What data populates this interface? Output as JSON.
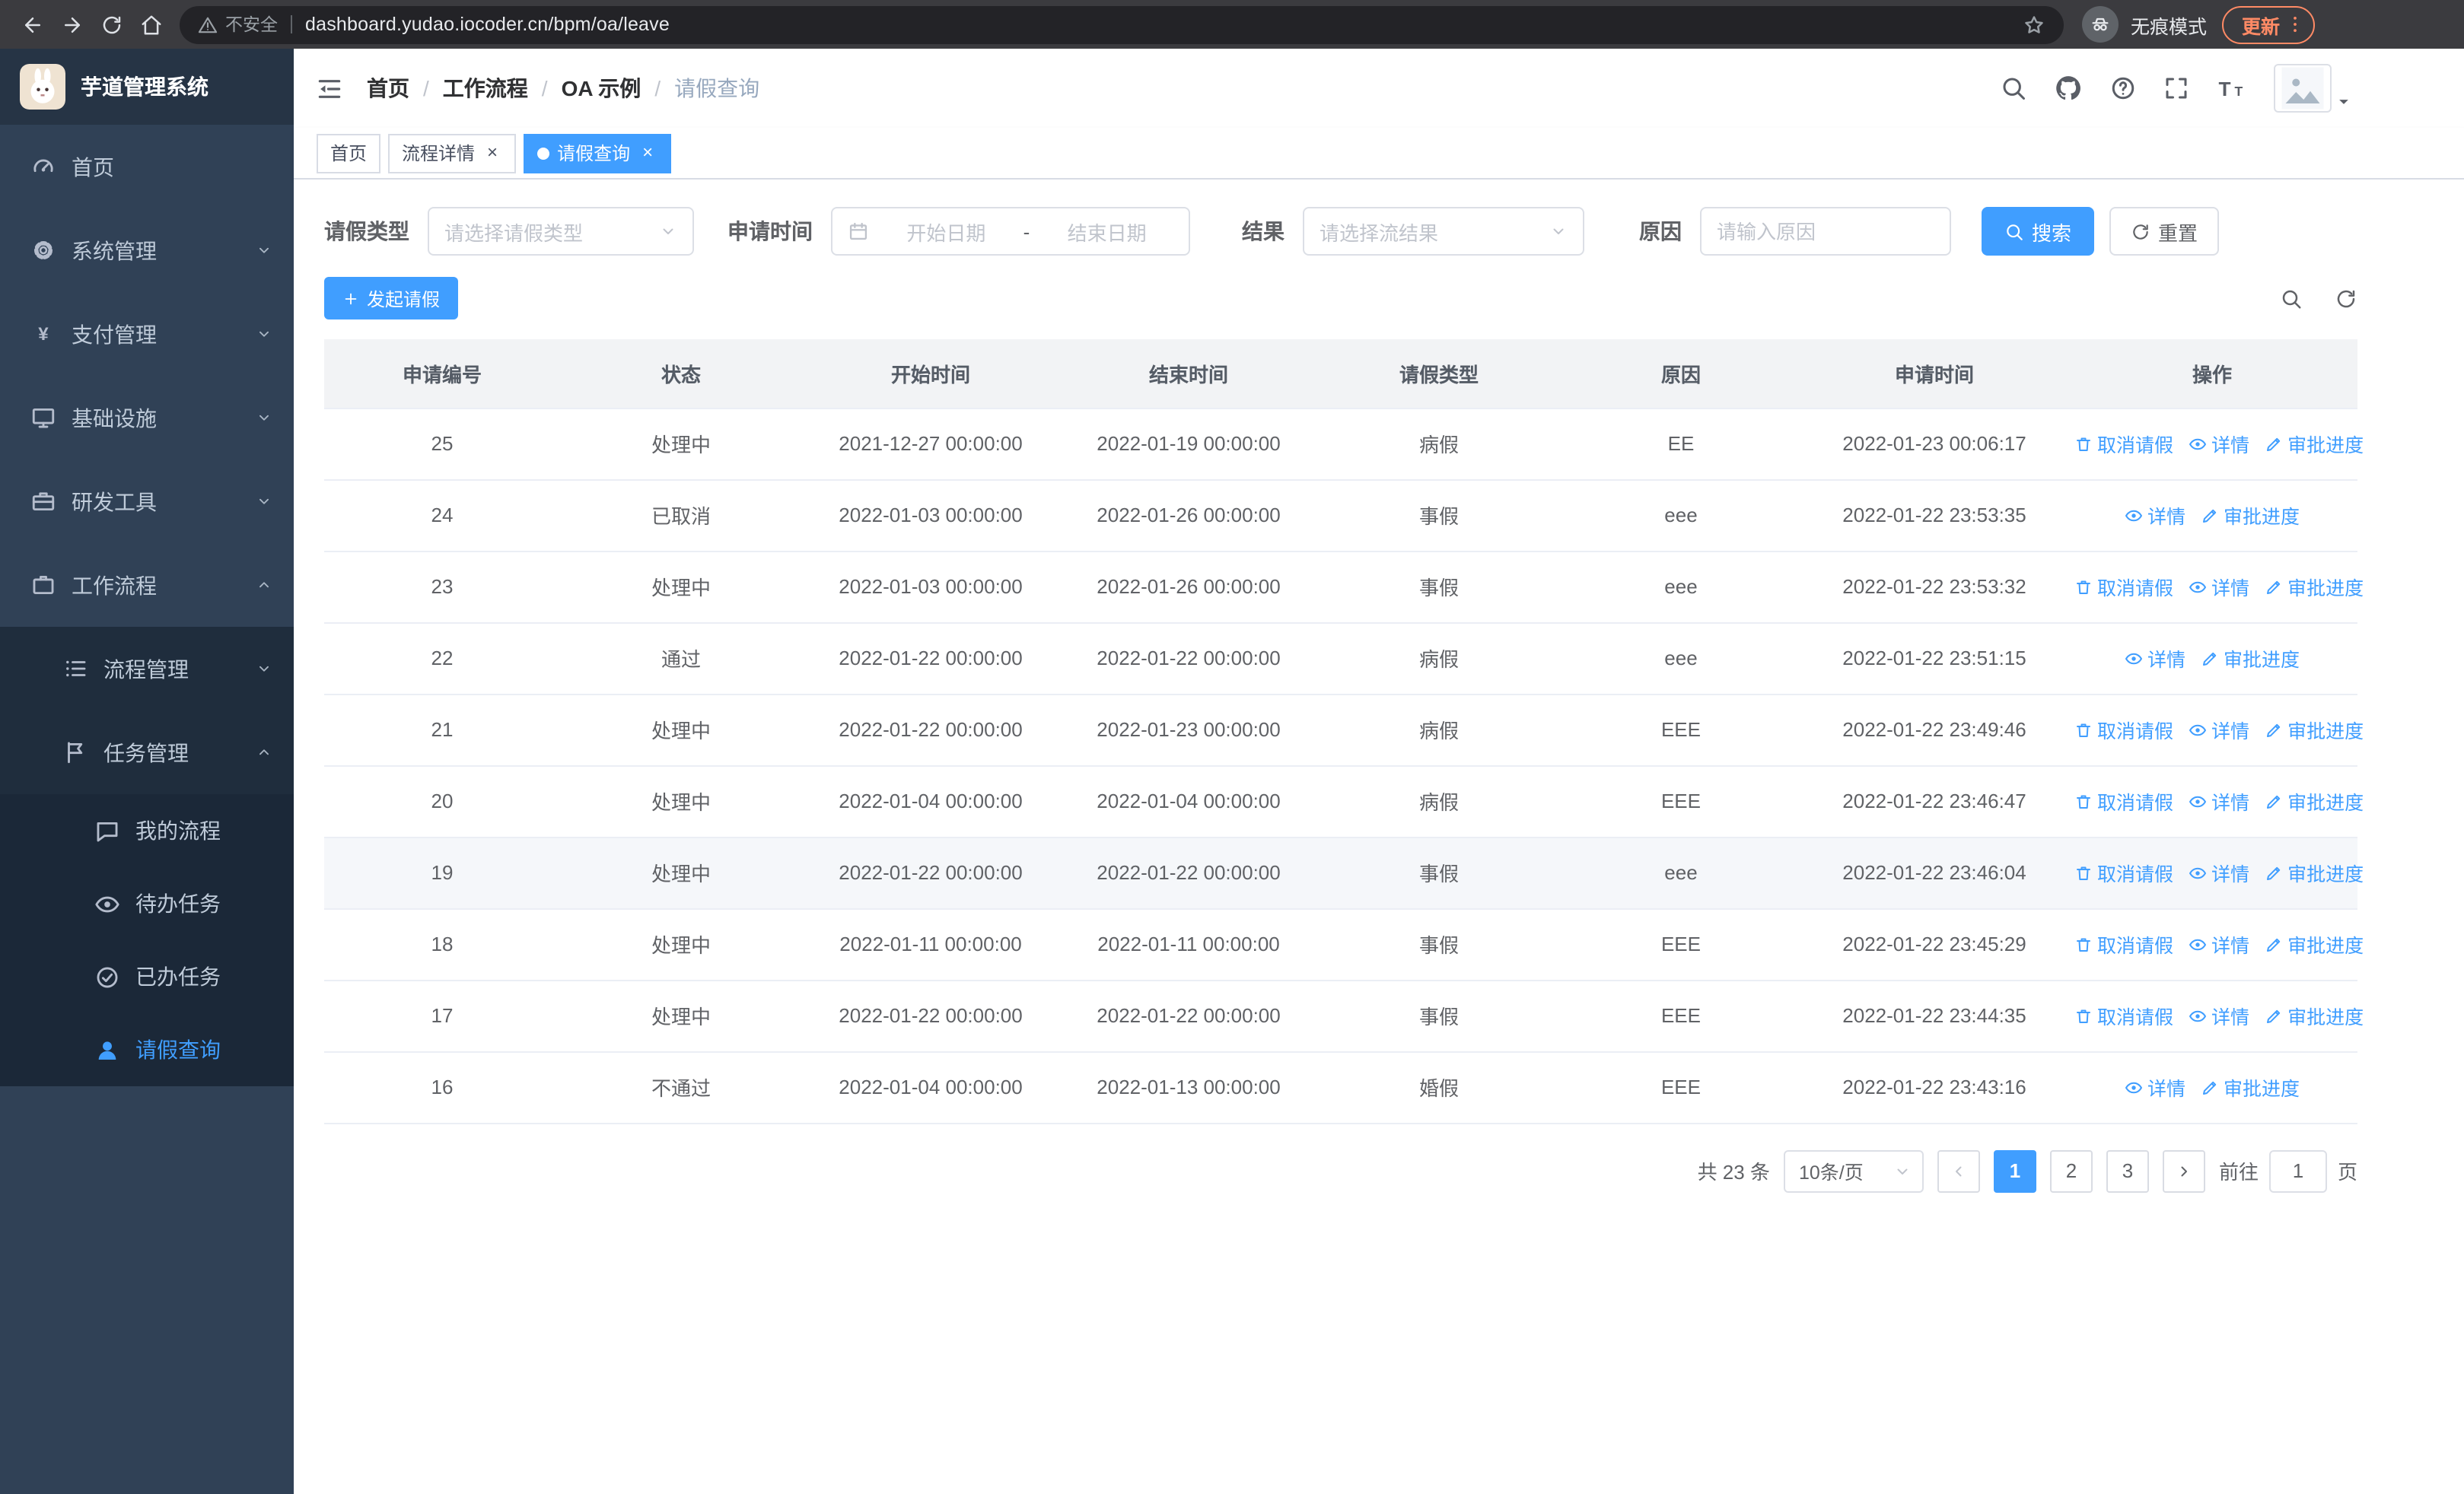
{
  "colors": {
    "accent": "#409eff",
    "link": "#409eff",
    "sidebar_bg": "#304156",
    "sidebar_submenu_bg": "#1f2d3d",
    "sidebar_text": "#bfcbd9",
    "update_chip": "#ff8a65",
    "table_header_bg": "#f2f3f5"
  },
  "browser": {
    "security_label": "不安全",
    "url": "dashboard.yudao.iocoder.cn/bpm/oa/leave",
    "incognito_label": "无痕模式",
    "update_label": "更新"
  },
  "sidebar": {
    "logo_title": "芋道管理系统",
    "menu": [
      {
        "key": "home",
        "label": "首页",
        "icon": "gauge"
      },
      {
        "key": "system",
        "label": "系统管理",
        "icon": "gear",
        "has_children": true,
        "expanded": false
      },
      {
        "key": "payment",
        "label": "支付管理",
        "icon": "yen",
        "has_children": true,
        "expanded": false
      },
      {
        "key": "infra",
        "label": "基础设施",
        "icon": "monitor",
        "has_children": true,
        "expanded": false
      },
      {
        "key": "devtools",
        "label": "研发工具",
        "icon": "briefcase",
        "has_children": true,
        "expanded": false
      },
      {
        "key": "workflow",
        "label": "工作流程",
        "icon": "suitcase",
        "has_children": true,
        "expanded": true,
        "children": [
          {
            "key": "process-mgmt",
            "label": "流程管理",
            "icon": "listicon",
            "has_children": true,
            "expanded": false
          },
          {
            "key": "task-mgmt",
            "label": "任务管理",
            "icon": "flag",
            "has_children": true,
            "expanded": true,
            "children": [
              {
                "key": "my-process",
                "label": "我的流程",
                "icon": "chat"
              },
              {
                "key": "todo-tasks",
                "label": "待办任务",
                "icon": "eye"
              },
              {
                "key": "done-tasks",
                "label": "已办任务",
                "icon": "check"
              },
              {
                "key": "leave-query",
                "label": "请假查询",
                "icon": "user",
                "active": true
              }
            ]
          }
        ]
      }
    ]
  },
  "header": {
    "breadcrumb": [
      "首页",
      "工作流程",
      "OA 示例",
      "请假查询"
    ]
  },
  "tabs": [
    {
      "label": "首页",
      "closable": false,
      "active": false
    },
    {
      "label": "流程详情",
      "closable": true,
      "active": false
    },
    {
      "label": "请假查询",
      "closable": true,
      "active": true
    }
  ],
  "filters": {
    "leave_type": {
      "label": "请假类型",
      "placeholder": "请选择请假类型"
    },
    "apply_time": {
      "label": "申请时间",
      "start_placeholder": "开始日期",
      "separator": "-",
      "end_placeholder": "结束日期"
    },
    "result": {
      "label": "结果",
      "placeholder": "请选择流结果"
    },
    "reason": {
      "label": "原因",
      "placeholder": "请输入原因"
    },
    "search_label": "搜索",
    "reset_label": "重置"
  },
  "toolbar": {
    "create_label": "发起请假"
  },
  "table": {
    "columns": [
      "申请编号",
      "状态",
      "开始时间",
      "结束时间",
      "请假类型",
      "原因",
      "申请时间",
      "操作"
    ],
    "action_labels": {
      "cancel": "取消请假",
      "detail": "详情",
      "progress": "审批进度"
    },
    "rows": [
      {
        "id": "25",
        "status": "处理中",
        "start": "2021-12-27 00:00:00",
        "end": "2022-01-19 00:00:00",
        "type": "病假",
        "reason": "EE",
        "applied": "2022-01-23 00:06:17",
        "actions": [
          "cancel",
          "detail",
          "progress"
        ],
        "hovered": false
      },
      {
        "id": "24",
        "status": "已取消",
        "start": "2022-01-03 00:00:00",
        "end": "2022-01-26 00:00:00",
        "type": "事假",
        "reason": "eee",
        "applied": "2022-01-22 23:53:35",
        "actions": [
          "detail",
          "progress"
        ],
        "hovered": false
      },
      {
        "id": "23",
        "status": "处理中",
        "start": "2022-01-03 00:00:00",
        "end": "2022-01-26 00:00:00",
        "type": "事假",
        "reason": "eee",
        "applied": "2022-01-22 23:53:32",
        "actions": [
          "cancel",
          "detail",
          "progress"
        ],
        "hovered": false
      },
      {
        "id": "22",
        "status": "通过",
        "start": "2022-01-22 00:00:00",
        "end": "2022-01-22 00:00:00",
        "type": "病假",
        "reason": "eee",
        "applied": "2022-01-22 23:51:15",
        "actions": [
          "detail",
          "progress"
        ],
        "hovered": false
      },
      {
        "id": "21",
        "status": "处理中",
        "start": "2022-01-22 00:00:00",
        "end": "2022-01-23 00:00:00",
        "type": "病假",
        "reason": "EEE",
        "applied": "2022-01-22 23:49:46",
        "actions": [
          "cancel",
          "detail",
          "progress"
        ],
        "hovered": false
      },
      {
        "id": "20",
        "status": "处理中",
        "start": "2022-01-04 00:00:00",
        "end": "2022-01-04 00:00:00",
        "type": "病假",
        "reason": "EEE",
        "applied": "2022-01-22 23:46:47",
        "actions": [
          "cancel",
          "detail",
          "progress"
        ],
        "hovered": false
      },
      {
        "id": "19",
        "status": "处理中",
        "start": "2022-01-22 00:00:00",
        "end": "2022-01-22 00:00:00",
        "type": "事假",
        "reason": "eee",
        "applied": "2022-01-22 23:46:04",
        "actions": [
          "cancel",
          "detail",
          "progress"
        ],
        "hovered": true
      },
      {
        "id": "18",
        "status": "处理中",
        "start": "2022-01-11 00:00:00",
        "end": "2022-01-11 00:00:00",
        "type": "事假",
        "reason": "EEE",
        "applied": "2022-01-22 23:45:29",
        "actions": [
          "cancel",
          "detail",
          "progress"
        ],
        "hovered": false
      },
      {
        "id": "17",
        "status": "处理中",
        "start": "2022-01-22 00:00:00",
        "end": "2022-01-22 00:00:00",
        "type": "事假",
        "reason": "EEE",
        "applied": "2022-01-22 23:44:35",
        "actions": [
          "cancel",
          "detail",
          "progress"
        ],
        "hovered": false
      },
      {
        "id": "16",
        "status": "不通过",
        "start": "2022-01-04 00:00:00",
        "end": "2022-01-13 00:00:00",
        "type": "婚假",
        "reason": "EEE",
        "applied": "2022-01-22 23:43:16",
        "actions": [
          "detail",
          "progress"
        ],
        "hovered": false
      }
    ]
  },
  "pagination": {
    "total_label": "共 23 条",
    "page_size": "10条/页",
    "pages": [
      "1",
      "2",
      "3"
    ],
    "active_page": "1",
    "goto_label": "前往",
    "goto_value": "1",
    "goto_suffix": "页"
  }
}
